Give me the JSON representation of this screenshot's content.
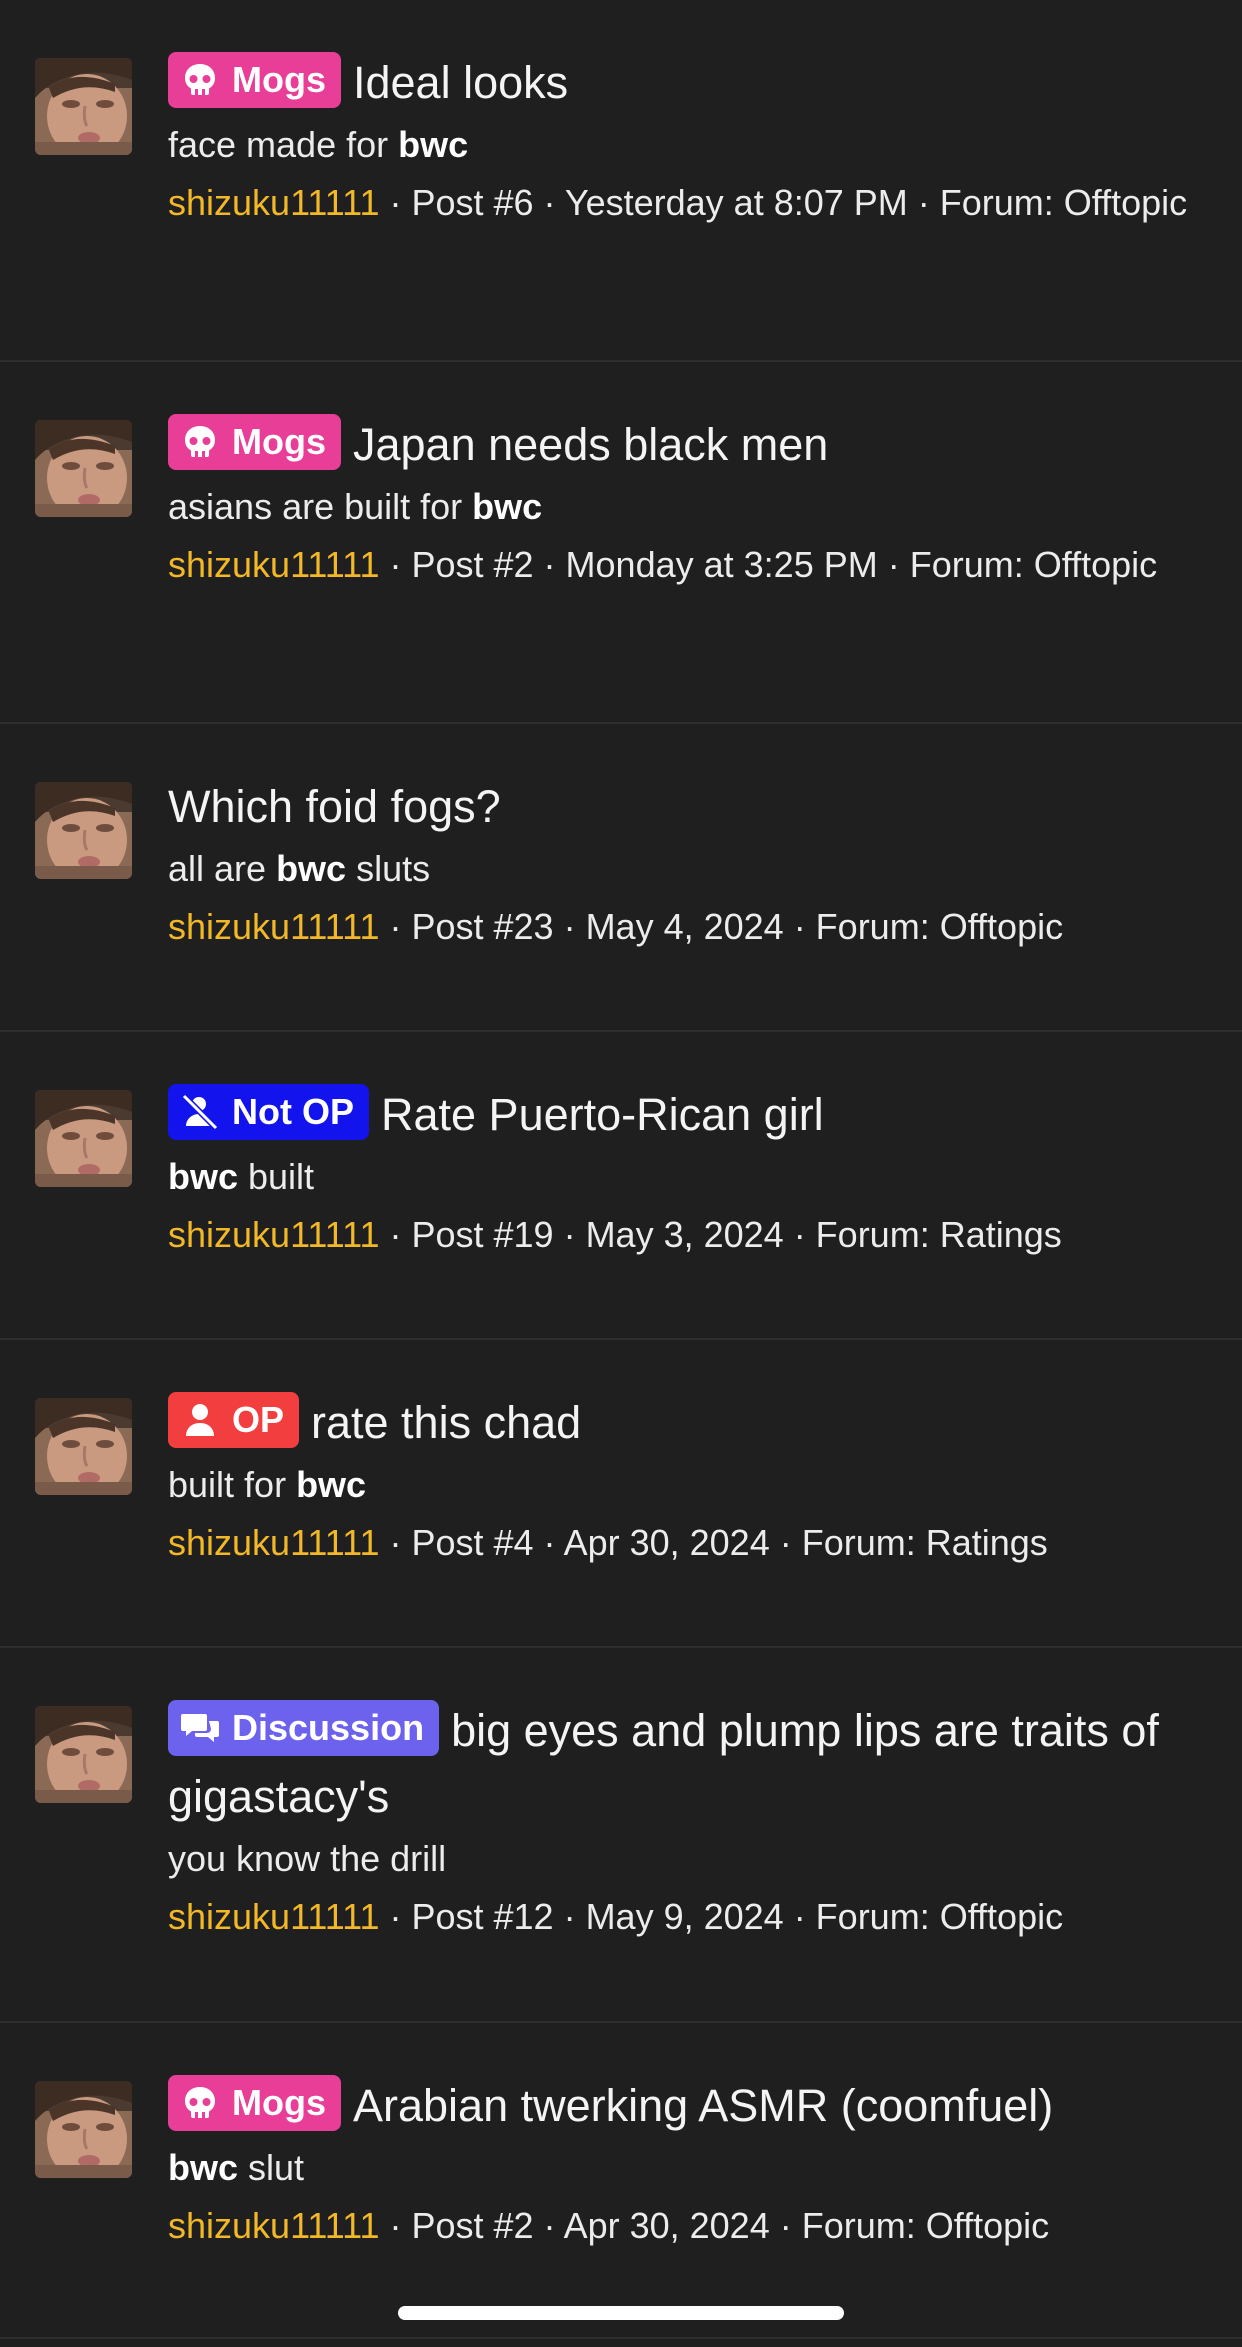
{
  "posts": [
    {
      "badge": {
        "label": "Mogs",
        "type": "mogs",
        "icon": "skull-icon",
        "color": "#e83e97"
      },
      "title": "Ideal looks",
      "snippet": {
        "before": "face made for ",
        "bold": "bwc",
        "after": ""
      },
      "user": "shizuku11111",
      "meta": " · Post #6 · Yesterday at 8:07 PM · Forum: Offtopic"
    },
    {
      "badge": {
        "label": "Mogs",
        "type": "mogs",
        "icon": "skull-icon",
        "color": "#e83e97"
      },
      "title": "Japan needs black men",
      "snippet": {
        "before": "asians are built for ",
        "bold": "bwc",
        "after": ""
      },
      "user": "shizuku11111",
      "meta": " · Post #2 · Monday at 3:25 PM · Forum: Offtopic"
    },
    {
      "badge": null,
      "title": "Which foid fogs?",
      "snippet": {
        "before": "all are ",
        "bold": "bwc",
        "after": " sluts"
      },
      "user": "shizuku11111",
      "meta": " · Post #23 · May 4, 2024 · Forum: Offtopic"
    },
    {
      "badge": {
        "label": "Not OP",
        "type": "notop",
        "icon": "user-slash-icon",
        "color": "#1313ee"
      },
      "title": "Rate Puerto-Rican girl",
      "snippet": {
        "before": "",
        "bold": "bwc",
        "after": " built"
      },
      "user": "shizuku11111",
      "meta": " · Post #19 · May 3, 2024 · Forum: Ratings"
    },
    {
      "badge": {
        "label": "OP",
        "type": "op",
        "icon": "user-icon",
        "color": "#f23e3e"
      },
      "title": "rate this chad",
      "snippet": {
        "before": "built for ",
        "bold": "bwc",
        "after": ""
      },
      "user": "shizuku11111",
      "meta": " · Post #4 · Apr 30, 2024 · Forum: Ratings"
    },
    {
      "badge": {
        "label": "Discussion",
        "type": "discussion",
        "icon": "chat-bubbles-icon",
        "color": "#6d62ee"
      },
      "title": "big eyes and plump lips are traits of gigastacy's",
      "snippet": {
        "before": "you know the drill",
        "bold": "",
        "after": ""
      },
      "user": "shizuku11111",
      "meta": " · Post #12 · May 9, 2024 · Forum: Offtopic"
    },
    {
      "badge": {
        "label": "Mogs",
        "type": "mogs",
        "icon": "skull-icon",
        "color": "#e83e97"
      },
      "title": "Arabian twerking ASMR (coomfuel)",
      "snippet": {
        "before": "",
        "bold": "bwc",
        "after": " slut"
      },
      "user": "shizuku11111",
      "meta": " · Post #2 · Apr 30, 2024 · Forum: Offtopic"
    }
  ],
  "colors": {
    "background": "#1f1f20",
    "username": "#f2b827",
    "divider": "#2e2e30"
  }
}
